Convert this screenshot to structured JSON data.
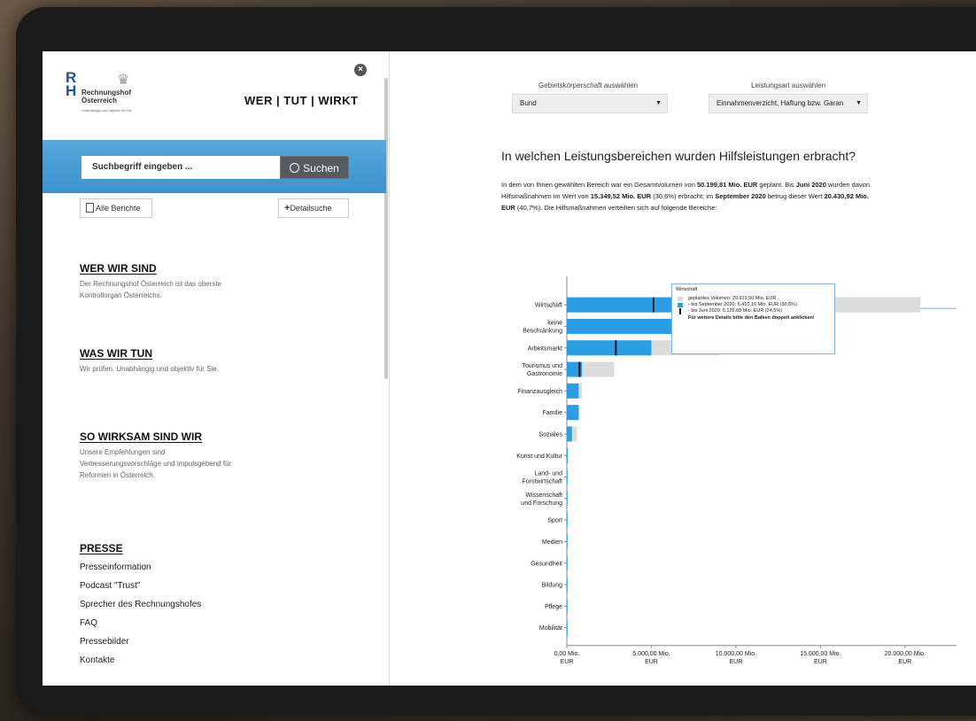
{
  "logo": {
    "mark": "R\nH",
    "name_line1": "Rechnungshof",
    "name_line2": "Österreich",
    "tagline": "Unabhängig und objektiv für Sie"
  },
  "header": {
    "tagline": "WER | TUT | WIRKT"
  },
  "search": {
    "placeholder": "Suchbegriff eingeben ...",
    "button_label": "Suchen"
  },
  "buttons": {
    "all_reports": "Alle Berichte",
    "detail_search": "Detailsuche"
  },
  "sections": [
    {
      "title": "WER WIR SIND",
      "text": "Der Rechnungshof Österreich ist das oberste Kontrollorgan Österreichs."
    },
    {
      "title": "WAS WIR TUN",
      "text": "Wir prüfen. Unabhängig und objektiv für Sie."
    },
    {
      "title": "SO WIRKSAM SIND WIR",
      "text": "Unsere Empfehlungen sind Verbesserungsvorschläge und impulsgebend für Reformen in Österreich."
    }
  ],
  "presse": {
    "title": "PRESSE",
    "links": [
      "Presseinformation",
      "Podcast \"Trust\"",
      "Sprecher des Rechnungshofes",
      "FAQ",
      "Pressebilder",
      "Kontakte"
    ]
  },
  "filters": {
    "gebiet_label": "Gebietskörperschaft auswählen",
    "gebiet_value": "Bund",
    "leistung_label": "Leistungsart auswählen",
    "leistung_value": "Einnahmenverzicht, Haftung bzw. Garan"
  },
  "question": "In welchen Leistungsbereichen wurden Hilfsleistungen erbracht?",
  "paragraph": {
    "p1": "In dem von Ihnen gewählten Bereich war ein Gesamtvolumen von ",
    "total": "50.199,81 Mio. EUR",
    "p2": " geplant. Bis ",
    "june": "Juni 2020",
    "p3": " wurden davon Hilfsmaßnahmen im Wert von ",
    "june_value": "15.349,52 Mio. EUR",
    "p4": " (30,6%) erbracht; im ",
    "sept": "September 2020",
    "p5": " betrug dieser Wert ",
    "sept_value": "20.430,92 Mio. EUR",
    "p6": " (40,7%). Die Hilfsmaßnahmen verteilten sich auf folgende Bereiche:"
  },
  "tooltip": {
    "title": "Wirtschaft",
    "planned": "geplantes Volumen: 20.919,50 Mio. EUR",
    "september": "- bis September 2020: 6.410,16 Mio. EUR (30,6%)",
    "june": "- bis Juni 2020: 5.125,68 Mio. EUR (24,5%)",
    "note": "Für weitere Details bitte den Balken doppelt anklicken!"
  },
  "colors": {
    "planned": "#dcdcdc",
    "september": "#2c9de0",
    "june": "#111111",
    "accent": "#3b92cf"
  },
  "chart_data": {
    "type": "bar",
    "orientation": "horizontal",
    "categories": [
      "Wirtschaft",
      "keine Beschränkung",
      "Arbeitsmarkt",
      "Tourismus und Gastronomie",
      "Finanzausgleich",
      "Familie",
      "Soziales",
      "Kunst und Kultur",
      "Land- und Forstwirtschaft",
      "Wissenschaft und Forschung",
      "Sport",
      "Medien",
      "Gesundheit",
      "Bildung",
      "Pflege",
      "Mobilität"
    ],
    "category_labels": [
      [
        "Wirtschaft"
      ],
      [
        "keine",
        "Beschränkung"
      ],
      [
        "Arbeitsmarkt"
      ],
      [
        "Tourismus und",
        "Gastronomie"
      ],
      [
        "Finanzausgleich"
      ],
      [
        "Familie"
      ],
      [
        "Soziales"
      ],
      [
        "Kunst und Kultur"
      ],
      [
        "Land- und",
        "Forstwirtschaft"
      ],
      [
        "Wissenschaft",
        "und Forschung"
      ],
      [
        "Sport"
      ],
      [
        "Medien"
      ],
      [
        "Gesundheit"
      ],
      [
        "Bildung"
      ],
      [
        "Pflege"
      ],
      [
        "Mobilität"
      ]
    ],
    "series": [
      {
        "name": "geplantes Volumen",
        "values": [
          20919.5,
          14000,
          9000,
          2800,
          900,
          750,
          600,
          80,
          40,
          30,
          20,
          15,
          10,
          10,
          10,
          5
        ]
      },
      {
        "name": "bis September 2020",
        "values": [
          6410.16,
          7000,
          5000,
          900,
          700,
          700,
          300,
          50,
          20,
          15,
          10,
          10,
          8,
          8,
          8,
          3
        ]
      },
      {
        "name": "bis Juni 2020",
        "values": [
          5125.68,
          6900,
          2900,
          750,
          0,
          0,
          0,
          0,
          0,
          0,
          0,
          0,
          0,
          0,
          0,
          0
        ]
      }
    ],
    "xlim": [
      0,
      22000
    ],
    "xticks": [
      0,
      5000,
      10000,
      15000,
      20000
    ],
    "xtick_labels": [
      [
        "0,00 Mio.",
        "EUR"
      ],
      [
        "5.000,00 Mio.",
        "EUR"
      ],
      [
        "10.000,00 Mio.",
        "EUR"
      ],
      [
        "15.000,00 Mio.",
        "EUR"
      ],
      [
        "20.000,00 Mio.",
        "EUR"
      ]
    ]
  }
}
